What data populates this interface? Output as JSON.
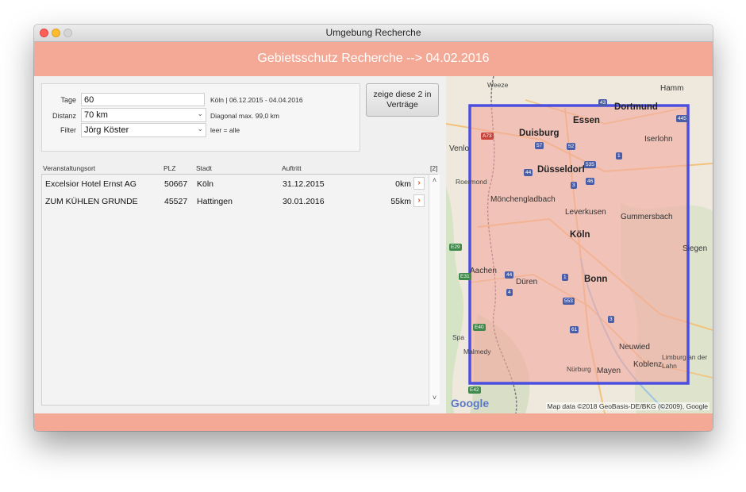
{
  "window": {
    "title": "Umgebung Recherche"
  },
  "header": {
    "title": "Gebietsschutz Recherche --> 04.02.2016"
  },
  "form": {
    "tage": {
      "label": "Tage",
      "value": "60",
      "note": "Köln | 06.12.2015 - 04.04.2016"
    },
    "distanz": {
      "label": "Distanz",
      "value": "70 km",
      "note": "Diagonal max. 99,0 km"
    },
    "filter": {
      "label": "Filter",
      "value": "Jörg Köster",
      "note": "leer = alle"
    }
  },
  "contracts_button": {
    "line1": "zeige diese 2 in",
    "line2": "Verträge"
  },
  "table": {
    "columns": {
      "ort": "Veranstaltungsort",
      "plz": "PLZ",
      "stadt": "Stadt",
      "auftritt": "Auftritt",
      "count": "[2]"
    },
    "rows": [
      {
        "ort": "Excelsior Hotel Ernst AG",
        "plz": "50667",
        "stadt": "Köln",
        "auftritt": "31.12.2015",
        "distance": "0km"
      },
      {
        "ort": "ZUM KÜHLEN GRUNDE",
        "plz": "45527",
        "stadt": "Hattingen",
        "auftritt": "30.01.2016",
        "distance": "55km"
      }
    ]
  },
  "map": {
    "labels": {
      "weeze": "Weeze",
      "hamm": "Hamm",
      "dortmund": "Dortmund",
      "essen": "Essen",
      "duisburg": "Duisburg",
      "venlo": "Venlo",
      "iserlohn": "Iserlohn",
      "duesseldorf": "Düsseldorf",
      "roermond": "Roermond",
      "moenchengladbach": "Mönchengladbach",
      "leverkusen": "Leverkusen",
      "gummersbach": "Gummersbach",
      "koeln": "Köln",
      "siegen": "Siegen",
      "aachen": "Aachen",
      "dueren": "Düren",
      "bonn": "Bonn",
      "spa": "Spa",
      "malmedy": "Malmedy",
      "neuwied": "Neuwied",
      "limburg": "Limburg an der Lahn",
      "koblenz": "Koblenz",
      "nuerburg": "Nürburg",
      "mayen": "Mayen"
    },
    "google_logo": "Google",
    "attribution": "Map data ©2018 GeoBasis-DE/BKG (©2009), Google",
    "colors": {
      "overlay_fill": "#f2a9a2",
      "overlay_border": "#4b4fe0"
    }
  }
}
